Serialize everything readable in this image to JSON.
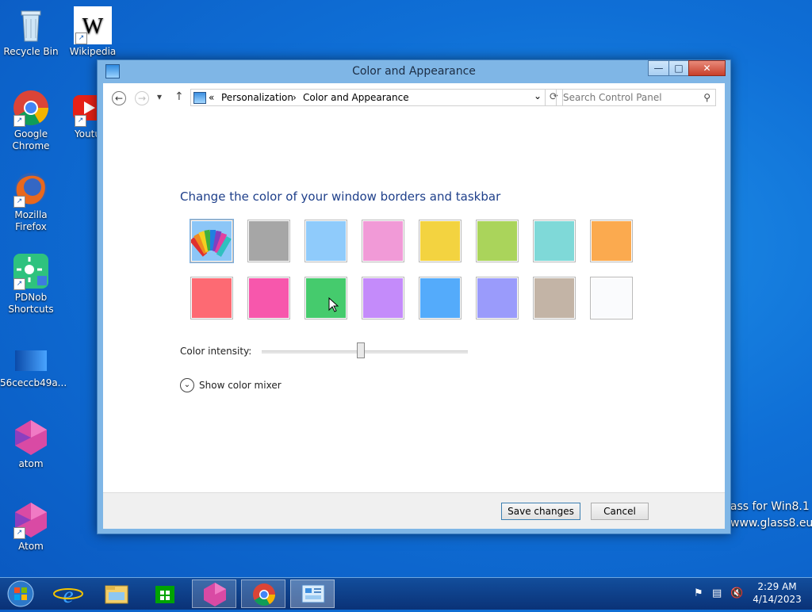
{
  "desktop": {
    "icons": [
      {
        "label": "Recycle Bin"
      },
      {
        "label": "Wikipedia"
      },
      {
        "label": "Google Chrome"
      },
      {
        "label": "Youtu"
      },
      {
        "label": "Mozilla Firefox"
      },
      {
        "label": "PDNob Shortcuts"
      },
      {
        "label": "56ceccb49a..."
      },
      {
        "label": "atom"
      },
      {
        "label": "Atom"
      }
    ],
    "watermark": {
      "line1": "lass for Win8.1",
      "line2": "www.glass8.eu"
    }
  },
  "window": {
    "title": "Color and Appearance",
    "controls": {
      "minimize": "—",
      "maximize": "□",
      "close": "✕"
    },
    "nav": {
      "back": "←",
      "forward": "→",
      "recent": "▾",
      "up": "↑"
    },
    "address": {
      "prefix": "«",
      "crumb1": "Personalization",
      "separator": "›",
      "crumb2": "Color and Appearance",
      "dropdown": "⌄"
    },
    "refresh": "⟳",
    "search": {
      "placeholder": "Search Control Panel",
      "icon": "⚲"
    },
    "heading": "Change the color of your window borders and taskbar",
    "swatches": [
      {
        "name": "automatic",
        "color": "#8cc6f7",
        "selected": true
      },
      {
        "name": "gray",
        "color": "#a6a6a6"
      },
      {
        "name": "light-blue",
        "color": "#8fcbfb"
      },
      {
        "name": "pink",
        "color": "#f19ad7"
      },
      {
        "name": "yellow",
        "color": "#f3d340"
      },
      {
        "name": "lime",
        "color": "#aad45b"
      },
      {
        "name": "teal",
        "color": "#7fd9d8"
      },
      {
        "name": "orange",
        "color": "#fbaa4f"
      },
      {
        "name": "red",
        "color": "#fd6a73"
      },
      {
        "name": "magenta",
        "color": "#f757ac"
      },
      {
        "name": "green",
        "color": "#45cb6d"
      },
      {
        "name": "violet",
        "color": "#c48bfa"
      },
      {
        "name": "blue",
        "color": "#54abfb"
      },
      {
        "name": "periwinkle",
        "color": "#9a9bfb"
      },
      {
        "name": "taupe",
        "color": "#c3b4a6"
      },
      {
        "name": "white",
        "color": "#fafbfd"
      }
    ],
    "intensity_label": "Color intensity:",
    "intensity_value": 0.48,
    "mixer_label": "Show color mixer",
    "mixer_glyph": "⌄",
    "buttons": {
      "save": "Save changes",
      "cancel": "Cancel"
    }
  },
  "taskbar": {
    "tray_icons": [
      "flag",
      "network",
      "volume-muted"
    ],
    "time": "2:29 AM",
    "date": "4/14/2023"
  }
}
